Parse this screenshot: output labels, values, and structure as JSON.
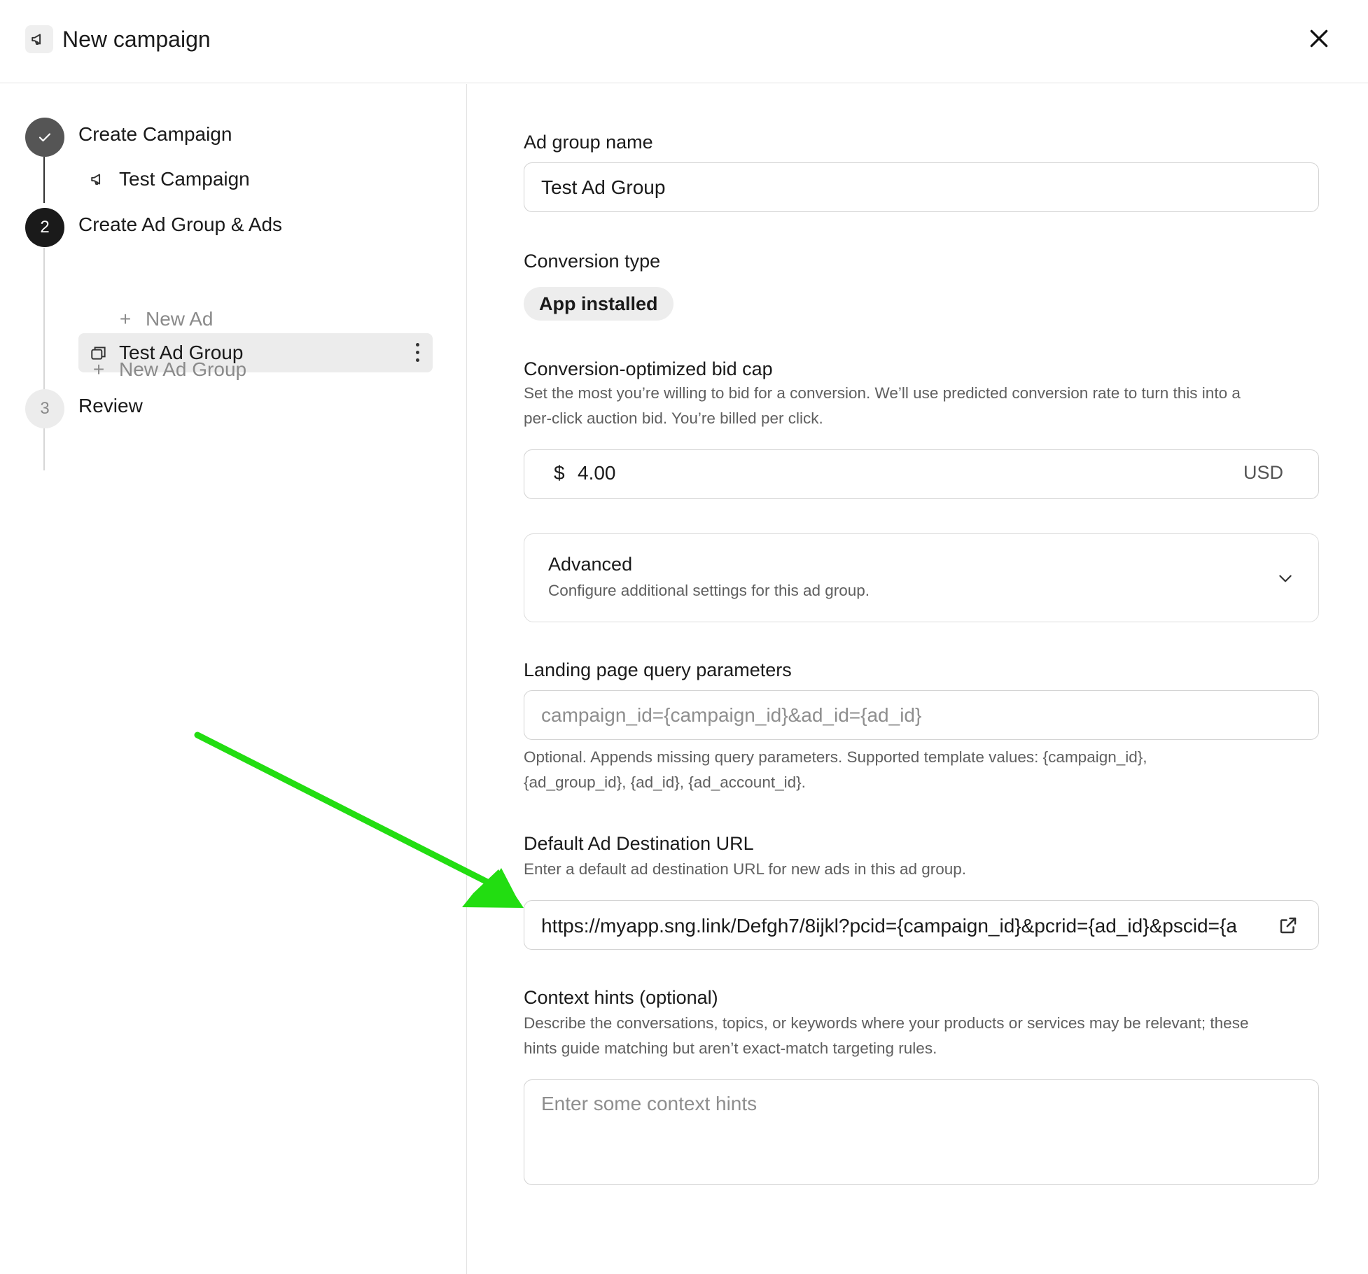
{
  "header": {
    "title": "New campaign",
    "icon": "megaphone-icon",
    "close_icon": "close-icon"
  },
  "sidebar": {
    "steps": [
      {
        "number": "✓",
        "label": "Create Campaign",
        "status": "complete"
      },
      {
        "number": "2",
        "label": "Create Ad Group & Ads",
        "status": "current"
      },
      {
        "number": "3",
        "label": "Review",
        "status": "upcoming"
      }
    ],
    "campaign_item": "Test Campaign",
    "ad_group_item": "Test Ad Group",
    "new_ad": "New Ad",
    "new_ad_group": "New Ad Group",
    "plus": "+"
  },
  "form": {
    "ad_group_name": {
      "label": "Ad group name",
      "value": "Test Ad Group"
    },
    "conversion_type": {
      "label": "Conversion type",
      "value": "App installed"
    },
    "bid_cap": {
      "label": "Conversion-optimized bid cap",
      "help_line1": "Set the most you’re willing to bid for a conversion. We’ll use predicted conversion rate to turn this into a",
      "help_line2": "per-click auction bid. You’re billed per click.",
      "currency_symbol": "$",
      "value": "4.00",
      "unit": "USD"
    },
    "advanced": {
      "title": "Advanced",
      "subtitle": "Configure additional settings for this ad group."
    },
    "query_params": {
      "label": "Landing page query parameters",
      "placeholder": "campaign_id={campaign_id}&ad_id={ad_id}",
      "help_line1": "Optional. Appends missing query parameters. Supported template values: {campaign_id},",
      "help_line2": "{ad_group_id}, {ad_id}, {ad_account_id}."
    },
    "destination_url": {
      "label": "Default Ad Destination URL",
      "help": "Enter a default ad destination URL for new ads in this ad group.",
      "value": "https://myapp.sng.link/Defgh7/8ijkl?pcid={campaign_id}&pcrid={ad_id}&pscid={a"
    },
    "context_hints": {
      "label": "Context hints (optional)",
      "help_line1": "Describe the conversations, topics, or keywords where your products or services may be relevant; these",
      "help_line2": "hints guide matching but aren’t exact-match targeting rules.",
      "placeholder": "Enter some context hints"
    }
  },
  "colors": {
    "annotation_arrow": "#22dd11",
    "step_complete": "#555555",
    "step_current": "#1a1a1a",
    "step_upcoming": "#ececec"
  }
}
